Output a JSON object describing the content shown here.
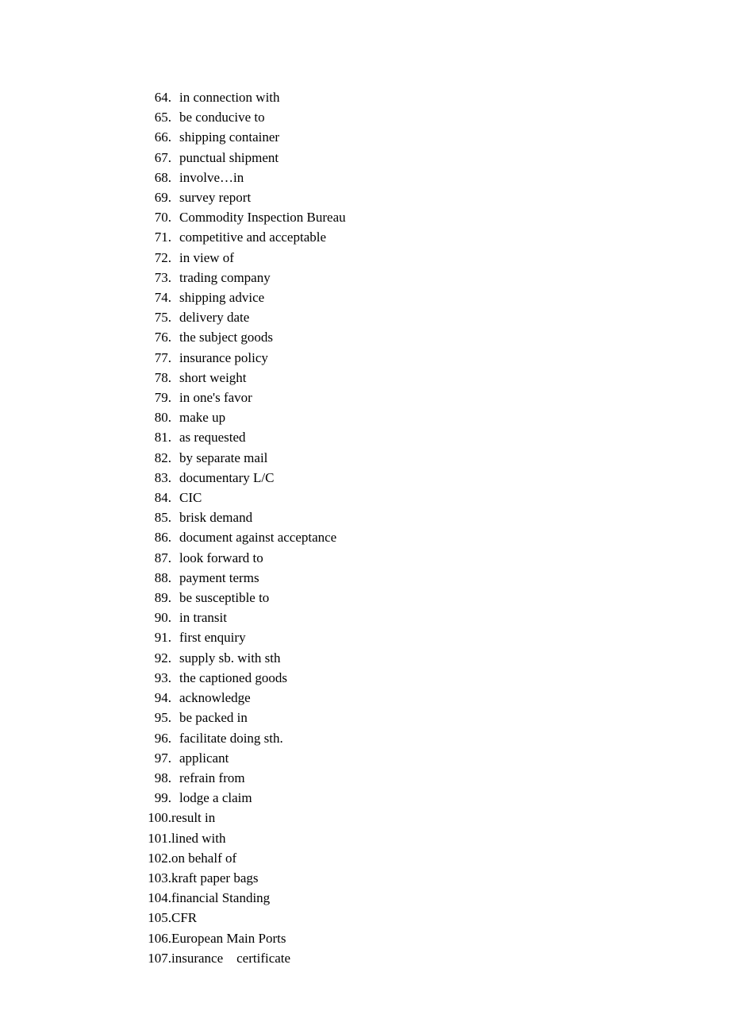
{
  "items": [
    {
      "n": "64.",
      "gap": "wide",
      "t": "in connection with"
    },
    {
      "n": "65.",
      "gap": "wide",
      "t": "be conducive to"
    },
    {
      "n": "66.",
      "gap": "wide",
      "t": "shipping container"
    },
    {
      "n": "67.",
      "gap": "wide",
      "t": "punctual shipment"
    },
    {
      "n": "68.",
      "gap": "wide",
      "t": "involve…in"
    },
    {
      "n": "69.",
      "gap": "wide",
      "t": "survey report"
    },
    {
      "n": "70.",
      "gap": "wide",
      "t": "Commodity Inspection Bureau"
    },
    {
      "n": "71.",
      "gap": "wide",
      "t": "competitive and acceptable"
    },
    {
      "n": "72.",
      "gap": "wide",
      "t": "in view of"
    },
    {
      "n": "73.",
      "gap": "wide",
      "t": "trading company"
    },
    {
      "n": "74.",
      "gap": "wide",
      "t": "shipping advice"
    },
    {
      "n": "75.",
      "gap": "wide",
      "t": "delivery date"
    },
    {
      "n": "76.",
      "gap": "wide",
      "t": "the subject goods"
    },
    {
      "n": "77.",
      "gap": "wide",
      "t": "insurance policy"
    },
    {
      "n": "78.",
      "gap": "wide",
      "t": "short weight"
    },
    {
      "n": "79.",
      "gap": "wide",
      "t": "in one's favor"
    },
    {
      "n": "80.",
      "gap": "wide",
      "t": "make up"
    },
    {
      "n": "81.",
      "gap": "wide",
      "t": "as requested"
    },
    {
      "n": "82.",
      "gap": "wide",
      "t": "by separate mail"
    },
    {
      "n": "83.",
      "gap": "wide",
      "t": "documentary L/C"
    },
    {
      "n": "84.",
      "gap": "wide",
      "t": "CIC"
    },
    {
      "n": "85.",
      "gap": "wide",
      "t": "brisk demand"
    },
    {
      "n": "86.",
      "gap": "wide",
      "t": "document against acceptance"
    },
    {
      "n": "87.",
      "gap": "wide",
      "t": "look forward to"
    },
    {
      "n": "88.",
      "gap": "wide",
      "t": "payment terms"
    },
    {
      "n": "89.",
      "gap": "wide",
      "t": "be susceptible to"
    },
    {
      "n": "90.",
      "gap": "wide",
      "t": "in transit"
    },
    {
      "n": "91.",
      "gap": "wide",
      "t": "first enquiry"
    },
    {
      "n": "92.",
      "gap": "wide",
      "t": "supply sb. with sth"
    },
    {
      "n": "93.",
      "gap": "wide",
      "t": "the captioned goods"
    },
    {
      "n": "94.",
      "gap": "wide",
      "t": "acknowledge"
    },
    {
      "n": "95.",
      "gap": "wide",
      "t": "be packed in"
    },
    {
      "n": "96.",
      "gap": "wide",
      "t": "facilitate doing sth."
    },
    {
      "n": "97.",
      "gap": "wide",
      "t": "applicant"
    },
    {
      "n": "98.",
      "gap": "wide",
      "t": "refrain from"
    },
    {
      "n": "99.",
      "gap": "wide",
      "t": "lodge a claim"
    },
    {
      "n": "100.",
      "gap": "none",
      "t": "result in"
    },
    {
      "n": "101.",
      "gap": "none",
      "t": "lined with"
    },
    {
      "n": "102.",
      "gap": "none",
      "t": "on behalf of"
    },
    {
      "n": "103.",
      "gap": "none",
      "t": "kraft paper bags"
    },
    {
      "n": "104.",
      "gap": "none",
      "t": "financial Standing"
    },
    {
      "n": "105.",
      "gap": "none",
      "t": "CFR"
    },
    {
      "n": "106.",
      "gap": "none",
      "t": "European Main Ports"
    },
    {
      "n": "107.",
      "gap": "none",
      "t": "insurance    certificate"
    }
  ]
}
